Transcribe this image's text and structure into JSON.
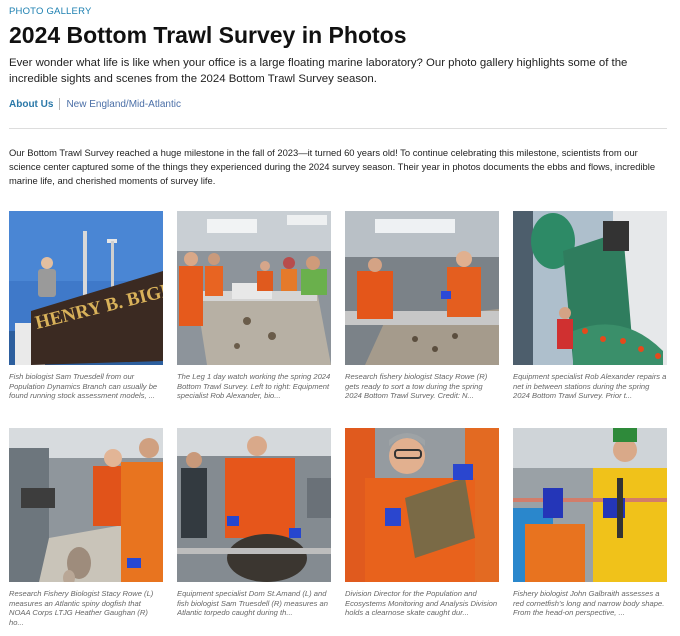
{
  "header": {
    "eyebrow": "PHOTO GALLERY",
    "title": "2024 Bottom Trawl Survey in Photos",
    "intro": "Ever wonder what life is like when your office is a large floating marine laboratory? Our photo gallery highlights some of the incredible sights and scenes from the 2024 Bottom Trawl Survey season."
  },
  "tags": {
    "about": "About Us",
    "region": "New England/Mid-Atlantic"
  },
  "body": "Our Bottom Trawl Survey reached a huge milestone in the fall of 2023—it turned 60 years old! To continue celebrating this milestone, scientists from our science center captured some of the things they experienced during the 2024 survey season. Their year in photos documents the ebbs and flows, incredible marine life, and cherished moments of survey life.",
  "gallery": [
    {
      "photo": "ship-bridge-nameplate",
      "sign_text": "HENRY B. BIGELOW",
      "caption": "Fish biologist Sam Truesdell from our Population Dynamics Branch can usually be found running stock assessment models, ..."
    },
    {
      "photo": "lab-watch-crew",
      "caption": "The Leg 1 day watch working the spring 2024 Bottom Trawl Survey. Left to right: Equipment specialist Rob Alexander, bio..."
    },
    {
      "photo": "sorting-conveyor",
      "caption": "Research fishery biologist Stacy Rowe (R) gets ready to sort a tow during the spring 2024 Bottom Trawl Survey. Credit: N..."
    },
    {
      "photo": "net-repair-deck",
      "caption": "Equipment specialist Rob Alexander repairs a net in between stations during the spring 2024 Bottom Trawl Survey. Prior t..."
    },
    {
      "photo": "dogfish-measuring",
      "caption": "Research Fishery Biologist Stacy Rowe (L) measures an Atlantic spiny dogfish that NOAA Corps LTJG Heather Gaughan (R) ho..."
    },
    {
      "photo": "torpedo-ray",
      "caption": "Equipment specialist Dom St.Amand (L) and fish biologist Sam Truesdell (R) measures an Atlantic torpedo caught during th..."
    },
    {
      "photo": "skate-holding",
      "caption": "Division Director for the Population and Ecosystems Monitoring and Analysis Division holds a clearnose skate caught dur..."
    },
    {
      "photo": "cornetfish-measure",
      "caption": "Fishery biologist John Galbraith assesses a red cornetfish's long and narrow body shape. From the head-on perspective, ..."
    }
  ]
}
